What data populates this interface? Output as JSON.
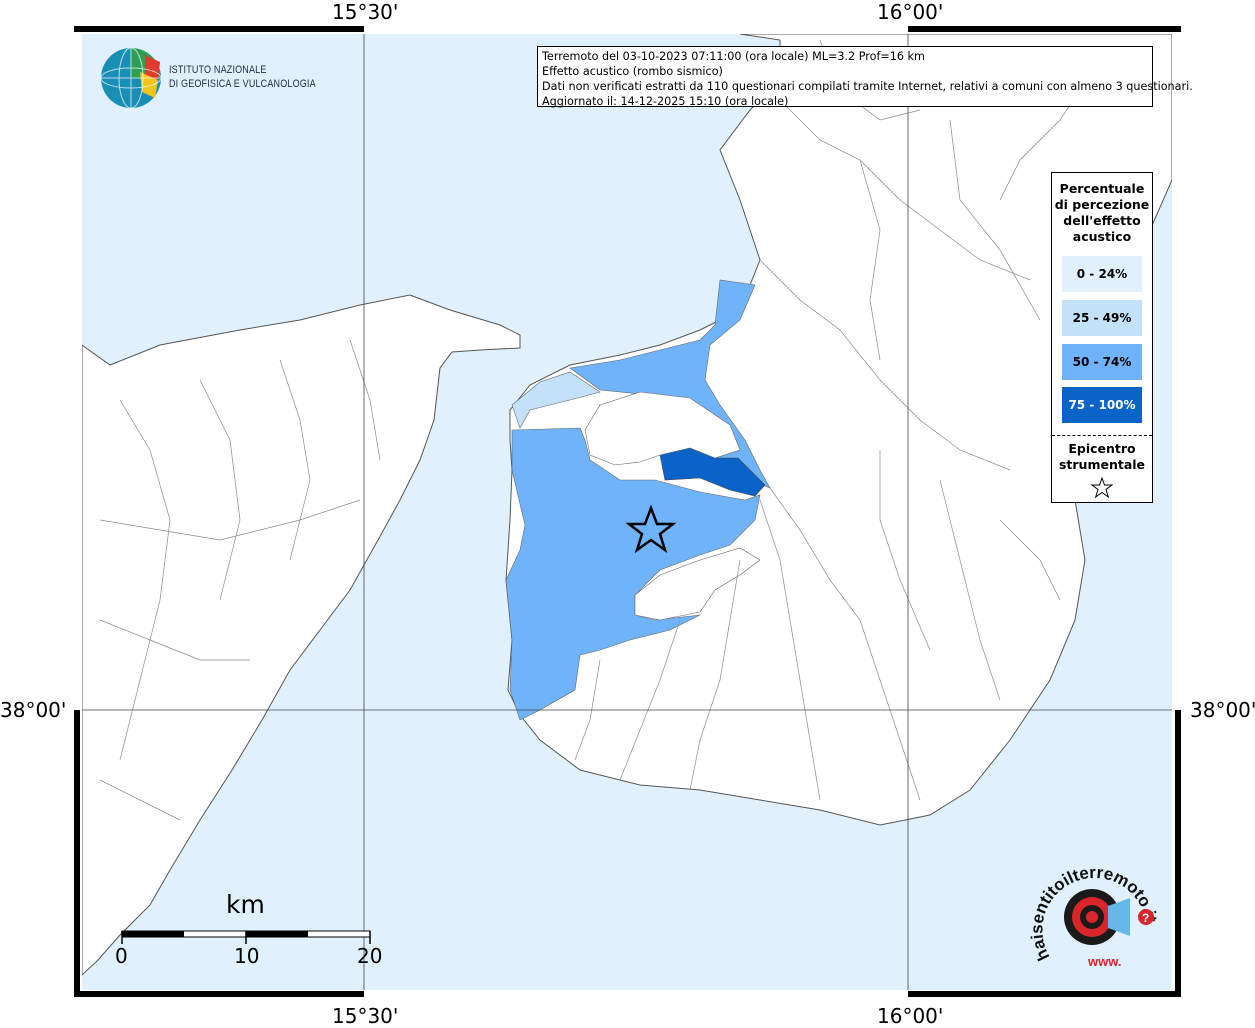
{
  "frame": {
    "lon_labels": [
      "15°30'",
      "16°00'"
    ],
    "lat_label": "38°00'"
  },
  "info": {
    "line1": "Terremoto del 03-10-2023 07:11:00 (ora locale) ML=3.2 Prof=16 km",
    "line2": "Effetto acustico (rombo sismico)",
    "line3": "Dati non verificati estratti da 110 questionari compilati tramite Internet, relativi a comuni con almeno 3 questionari.",
    "line4": "Aggiornato il: 14-12-2025 15:10 (ora locale)"
  },
  "logo": {
    "line1": "ISTITUTO NAZIONALE",
    "line2": "DI GEOFISICA E VULCANOLOGIA"
  },
  "legend": {
    "title_lines": [
      "Percentuale",
      "di percezione",
      "dell'effetto",
      "acustico"
    ],
    "items": [
      {
        "label": "0 - 24%",
        "color": "#e0f1fd"
      },
      {
        "label": "25 - 49%",
        "color": "#c4e1fa"
      },
      {
        "label": "50 - 74%",
        "color": "#6fb4fb"
      },
      {
        "label": "75 - 100%",
        "color": "#0a63c9"
      }
    ],
    "epicenter_lines": [
      "Epicentro",
      "strumentale"
    ]
  },
  "scalebar": {
    "unit": "km",
    "ticks": [
      "0",
      "10",
      "20"
    ]
  },
  "watermark": {
    "text": "haisentitoilterremoto.it",
    "prefix": "www."
  },
  "colors": {
    "sea": "#e0f1fd",
    "land": "#ffffff",
    "class_50_74": "#6fb4fb",
    "class_75_100": "#0a63c9",
    "class_25_49": "#c4e1fa"
  }
}
